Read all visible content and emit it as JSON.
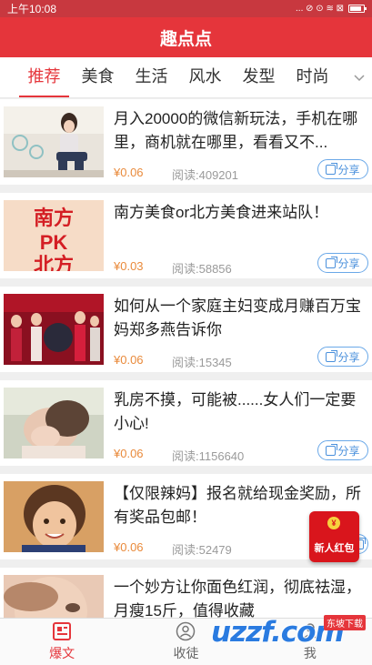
{
  "status": {
    "time": "上午10:08",
    "icons_text": "... ⊘ ⊙ ≋ ⊠"
  },
  "app": {
    "title": "趣点点"
  },
  "tabs": [
    {
      "label": "推荐",
      "active": true
    },
    {
      "label": "美食"
    },
    {
      "label": "生活"
    },
    {
      "label": "风水"
    },
    {
      "label": "发型"
    },
    {
      "label": "时尚"
    }
  ],
  "tabs_more_icon": "chevron-down-icon",
  "articles": [
    {
      "title": "月入20000的微信新玩法，手机在哪里，商机就在哪里，看看又不...",
      "price": "¥0.06",
      "reads": "阅读:409201",
      "share": "分享",
      "thumb": "woman-lifestyle-photo"
    },
    {
      "title": "南方美食or北方美食进来站队！",
      "price": "¥0.03",
      "reads": "阅读:58856",
      "share": "分享",
      "thumb_text": [
        "南方",
        "PK",
        "北方"
      ]
    },
    {
      "title": "如何从一个家庭主妇变成月赚百万宝妈郑多燕告诉你",
      "price": "¥0.06",
      "reads": "阅读:15345",
      "share": "分享",
      "thumb": "stage-event-photo"
    },
    {
      "title": "乳房不摸，可能被......女人们一定要小心!",
      "price": "¥0.06",
      "reads": "阅读:1156640",
      "share": "分享",
      "thumb": "woman-portrait-photo"
    },
    {
      "title": "【仅限辣妈】报名就给现金奖励，所有奖品包邮！",
      "price": "¥0.06",
      "reads": "阅读:52479",
      "share": "分享",
      "thumb": "child-portrait-photo"
    },
    {
      "title": "一个妙方让你面色红润，彻底祛湿，月瘦15斤，值得收藏",
      "price": "",
      "reads": "",
      "share": "",
      "thumb": "woman-face-photo"
    }
  ],
  "redpacket": {
    "label": "新人红包",
    "coin": "¥"
  },
  "bottom_nav": [
    {
      "label": "爆文",
      "icon": "news-icon",
      "active": true
    },
    {
      "label": "收徒",
      "icon": "person-icon"
    },
    {
      "label": "我",
      "icon": "profile-icon"
    }
  ],
  "watermark": {
    "text": "uzzf.com",
    "sub": "东坡下载"
  },
  "colors": {
    "brand": "#e5353b",
    "price": "#e98a3b",
    "share": "#4a90dc"
  }
}
